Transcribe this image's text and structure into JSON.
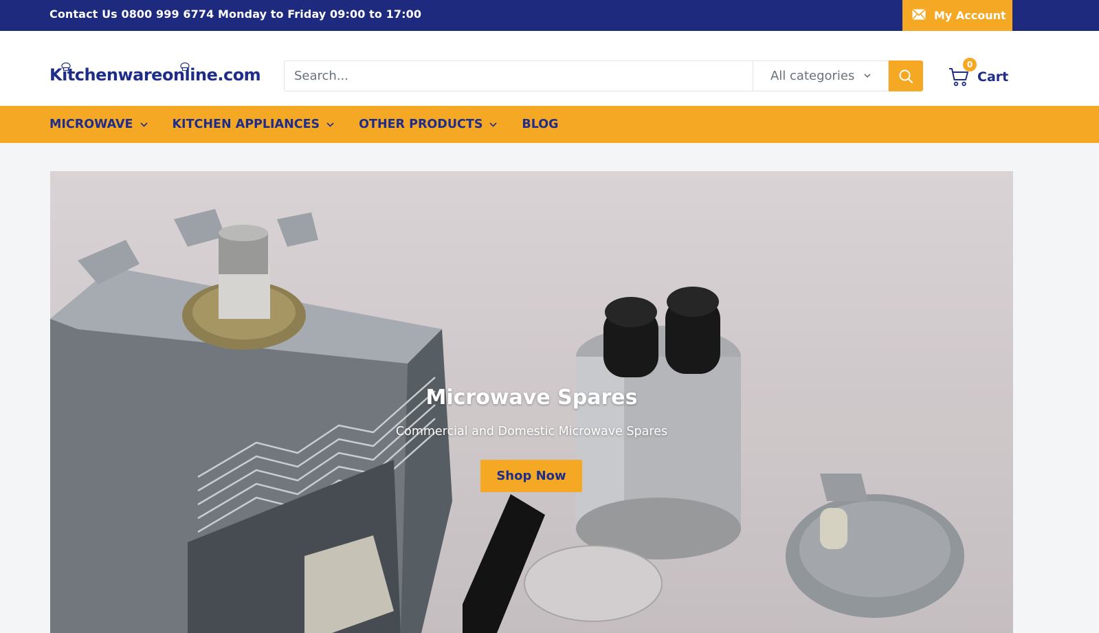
{
  "topbar": {
    "contact_text": "Contact Us 0800 999 6774 Monday to Friday 09:00 to 17:00",
    "account_label": "My Account",
    "account_icon": "mail-icon",
    "bg_color": "#1e2a7e"
  },
  "header": {
    "logo_text": "Kitchenwareonline.com",
    "search": {
      "placeholder": "Search...",
      "value": ""
    },
    "category_select": {
      "selected": "All categories"
    },
    "search_button_icon": "search-icon",
    "cart": {
      "label": "Cart",
      "count": "0",
      "icon": "cart-icon"
    }
  },
  "nav": {
    "items": [
      {
        "label": "Microwave",
        "has_dropdown": true
      },
      {
        "label": "Kitchen Appliances",
        "has_dropdown": true
      },
      {
        "label": "Other Products",
        "has_dropdown": true
      },
      {
        "label": "Blog",
        "has_dropdown": false
      }
    ],
    "bg_color": "#f4a823"
  },
  "hero": {
    "title": "Microwave Spares",
    "subtitle": "Commercial and Domestic Microwave Spares",
    "button_label": "Shop Now"
  },
  "colors": {
    "brand_blue": "#1f2d8a",
    "accent_orange": "#f4a823",
    "page_bg": "#f3f5f6"
  }
}
